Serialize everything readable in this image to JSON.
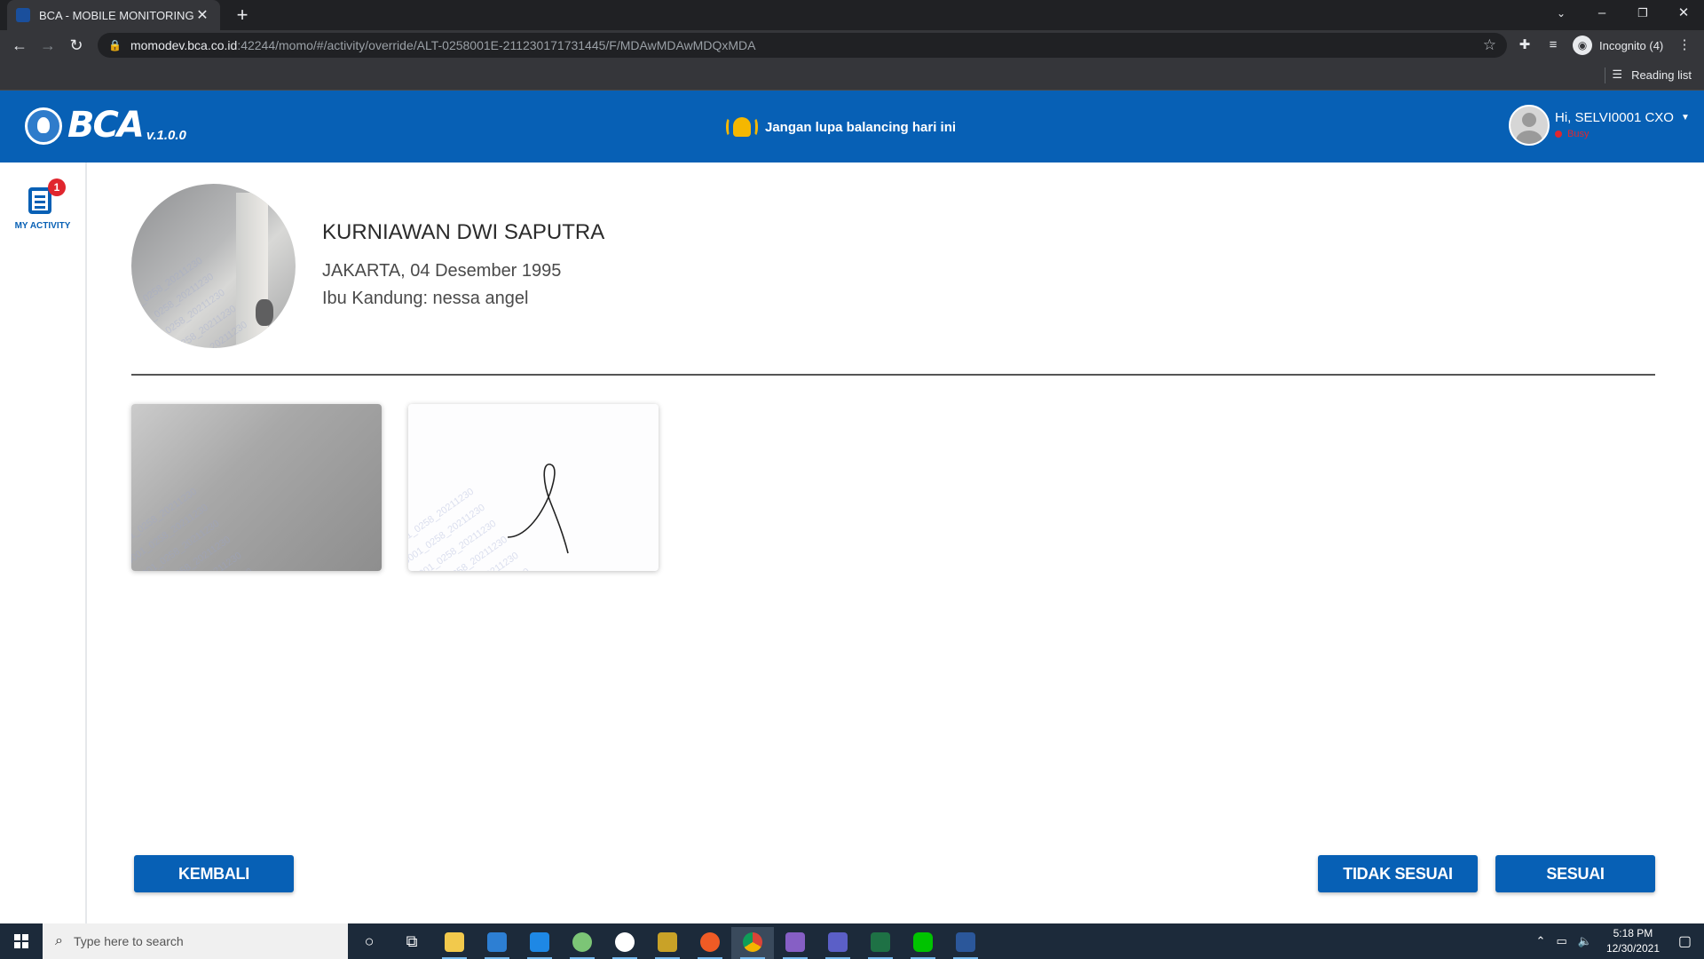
{
  "browser": {
    "tab_title": "BCA - MOBILE MONITORING",
    "tab_close": "✕",
    "new_tab": "+",
    "url_host": "momodev.bca.co.id",
    "url_rest": ":42244/momo/#/activity/override/ALT-0258001E-211230171731445/F/MDAwMDAwMDQxMDA",
    "incognito_label": "Incognito (4)",
    "reading_list": "Reading list"
  },
  "header": {
    "logo_text": "BCA",
    "version": "v.1.0.0",
    "reminder": "Jangan lupa balancing hari ini",
    "user_greeting": "Hi, SELVI0001 CXO",
    "user_status": "Busy"
  },
  "sidebar": {
    "items": [
      {
        "label": "MY ACTIVITY",
        "badge": "1",
        "icon": "activity-list-icon"
      }
    ]
  },
  "customer": {
    "name": "KURNIAWAN DWI SAPUTRA",
    "birth": "JAKARTA, 04 Desember 1995",
    "mother": "Ibu Kandung: nessa angel",
    "watermark": "SELVI0001_0258_20211230"
  },
  "actions": {
    "back": "KEMBALI",
    "not_match": "TIDAK SESUAI",
    "match": "SESUAI"
  },
  "taskbar": {
    "search_placeholder": "Type here to search",
    "time": "5:18 PM",
    "date": "12/30/2021"
  },
  "colors": {
    "brand_blue": "#0760b5",
    "busy_red": "#e0262e",
    "bell_yellow": "#f5b700"
  }
}
